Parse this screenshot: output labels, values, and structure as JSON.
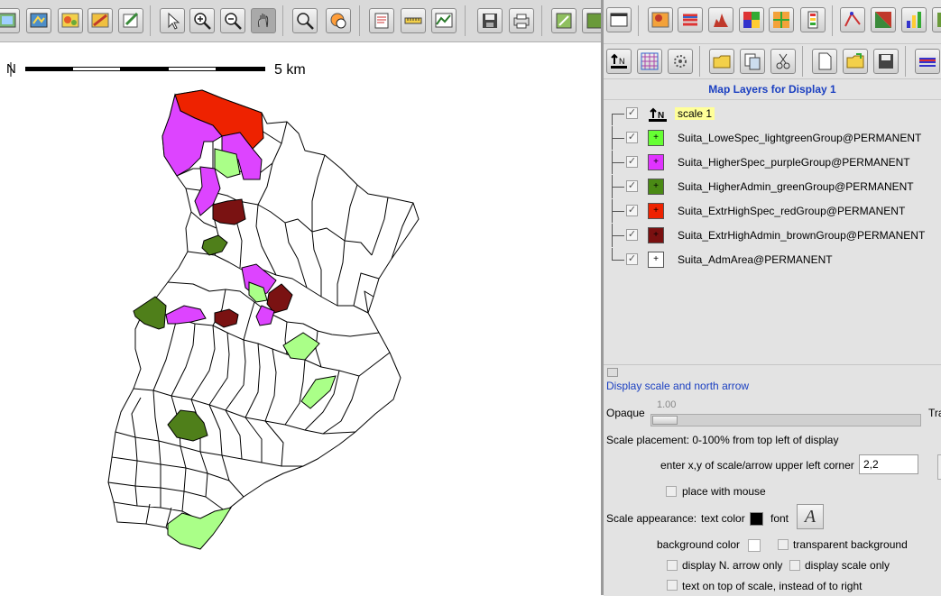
{
  "map_display": {
    "north_label": "N",
    "scale_label": "5  km",
    "toolbar_icons": [
      "display-icon",
      "redraw-icon",
      "render-map-icon",
      "erase-icon",
      "overlay-icon",
      "pointer-icon",
      "zoom-in-icon",
      "zoom-out-icon",
      "pan-icon",
      "zoom-menu-icon",
      "query-icon",
      "analyze-icon",
      "measure-icon",
      "profile-icon",
      "save-icon",
      "print-icon",
      "layer-manager-icon",
      "layer-manager-2-icon"
    ]
  },
  "layer_manager": {
    "title": "Map Layers for Display 1",
    "layers": [
      {
        "name": "scale 1",
        "swatch_color": "#ffffff",
        "swatch_icon": "scale-north-arrow-icon",
        "checked": true,
        "selected": true
      },
      {
        "name": "Suita_LoweSpec_lightgreenGroup@PERMANENT",
        "swatch_color": "#66ff33",
        "checked": true,
        "selected": false
      },
      {
        "name": "Suita_HigherSpec_purpleGroup@PERMANENT",
        "swatch_color": "#e033ff",
        "checked": true,
        "selected": false
      },
      {
        "name": "Suita_HigherAdmin_greenGroup@PERMANENT",
        "swatch_color": "#4a8a14",
        "checked": true,
        "selected": false
      },
      {
        "name": "Suita_ExtrHighSpec_redGroup@PERMANENT",
        "swatch_color": "#ee2200",
        "checked": true,
        "selected": false
      },
      {
        "name": "Suita_ExtrHighAdmin_brownGroup@PERMANENT",
        "swatch_color": "#7a1010",
        "checked": true,
        "selected": false
      },
      {
        "name": "Suita_AdmArea@PERMANENT",
        "swatch_color": "#ffffff",
        "checked": true,
        "selected": false
      }
    ]
  },
  "properties": {
    "section_title": "Display scale and north arrow",
    "opacity_value": "1.00",
    "opacity_fraction": 1.0,
    "opaque_label": "Opaque",
    "transparent_label": "Tra",
    "placement_label": "Scale placement: 0-100% from top left of display",
    "xy_label": "enter x,y of scale/arrow upper left corner",
    "xy_value": "2,2",
    "place_with_mouse": "place with mouse",
    "appearance_label": "Scale appearance:",
    "text_color_label": "text color",
    "text_color": "#000000",
    "font_label": "font",
    "font_glyph": "A",
    "background_color_label": "background color",
    "transparent_bg_label": "transparent background",
    "arrow_only_label": "display N. arrow only",
    "scale_only_label": "display scale only",
    "text_on_top_label": "text on top of scale, instead of to right"
  },
  "colors": {
    "lightgreen": "#aaff88",
    "purple": "#dd44ff",
    "green": "#4f7f1a",
    "red": "#ee2200",
    "brown": "#7a1212",
    "accent_blue": "#1a3fc1"
  }
}
